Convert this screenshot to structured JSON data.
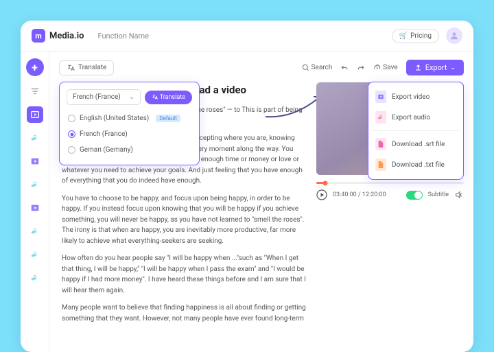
{
  "brand": "Media.io",
  "function_name": "Function Name",
  "pricing_label": "Pricing",
  "toolbar": {
    "translate": "Translate",
    "search": "Search",
    "save": "Save",
    "export": "Export"
  },
  "translate_panel": {
    "selected": "French (France)",
    "action": "Translate",
    "options": [
      {
        "label": "English (United States)",
        "default": true,
        "checked": false
      },
      {
        "label": "French (France)",
        "default": false,
        "checked": true
      },
      {
        "label": "Geman (Gemany)",
        "default": false,
        "checked": false
      }
    ],
    "default_badge": "Default"
  },
  "title": "ribe Upload a video",
  "paragraphs": [
    "ne to \"smell the roses\" — to This is part of being truly happy.",
    "Happiness is a state of mind. It starts with accepting where you are, knowing where you are going and planning to enjoy every moment along the way. You know how to be happy, and feel that you have enough time or money or love or whatever you need to achieve your goals. And just feeling that you have enough of everything that you do indeed have enough.",
    "You have to choose to be happy, and focus upon being happy, in order to be happy. If you instead focus upon knowing that you will be happy if you achieve something, you will never be happy, as you have not learned to \"smell the roses\". The irony is that when are happy, you are inevitably more productive,  far more likely to achieve what everything-seekers are seeking.",
    "How often do you hear people say \"I will be happy when ...\"such as \"When I get that thing, I will be happy,\" \"I will be happy when I pass the exam\" and \"I would be happy if I had more money\". I have heard these things before and I am sure that I will hear them again.",
    "Many people want to believe that finding happiness is all about finding or getting something that they want. However, not many people have ever found long-term"
  ],
  "export_menu": [
    {
      "label": "Export video",
      "color": "purple"
    },
    {
      "label": "Export audio",
      "color": "pink"
    },
    {
      "label": "Download .srt file",
      "color": "pink"
    },
    {
      "label": "Download .txt file",
      "color": "orange"
    }
  ],
  "player": {
    "time": "03:40:00 / 12:20:00",
    "subtitle_label": "Subtitle"
  }
}
